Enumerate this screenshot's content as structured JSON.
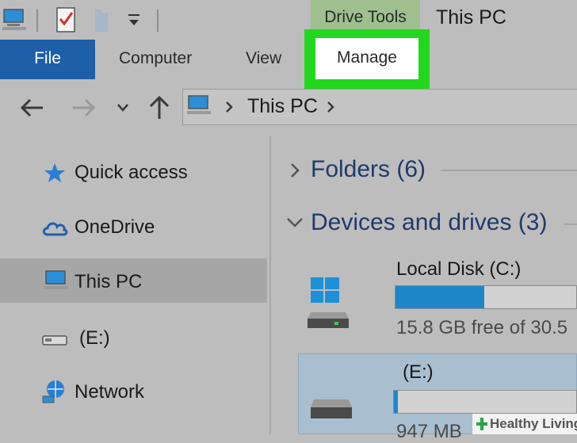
{
  "titlebar": {
    "context_tab": "Drive Tools",
    "window_title": "This PC"
  },
  "ribbon": {
    "file": "File",
    "tabs": [
      "Computer",
      "View",
      "Manage"
    ]
  },
  "address": {
    "path": "This PC"
  },
  "sidebar": {
    "items": [
      {
        "label": "Quick access",
        "icon": "star-icon"
      },
      {
        "label": "OneDrive",
        "icon": "cloud-icon"
      },
      {
        "label": "This PC",
        "icon": "computer-icon",
        "selected": true
      },
      {
        "label": "(E:)",
        "icon": "usb-drive-icon"
      },
      {
        "label": "Network",
        "icon": "network-icon"
      }
    ]
  },
  "main": {
    "groups": [
      {
        "title": "Folders (6)",
        "expanded": false
      },
      {
        "title": "Devices and drives (3)",
        "expanded": true
      }
    ],
    "drives": [
      {
        "name": "Local Disk (C:)",
        "free_text": "15.8 GB free of 30.5",
        "used_fraction": 0.49,
        "icon": "windows-drive-icon"
      },
      {
        "name": "(E:)",
        "free_text": "947 MB",
        "used_fraction": 0.02,
        "icon": "removable-drive-icon",
        "selected": true
      }
    ]
  },
  "watermark": "Healthy Living",
  "colors": {
    "accent": "#1d5fa8",
    "highlight": "#22d81e",
    "drive_bar": "#1e86c8",
    "context_tab": "#9fbf8f"
  }
}
